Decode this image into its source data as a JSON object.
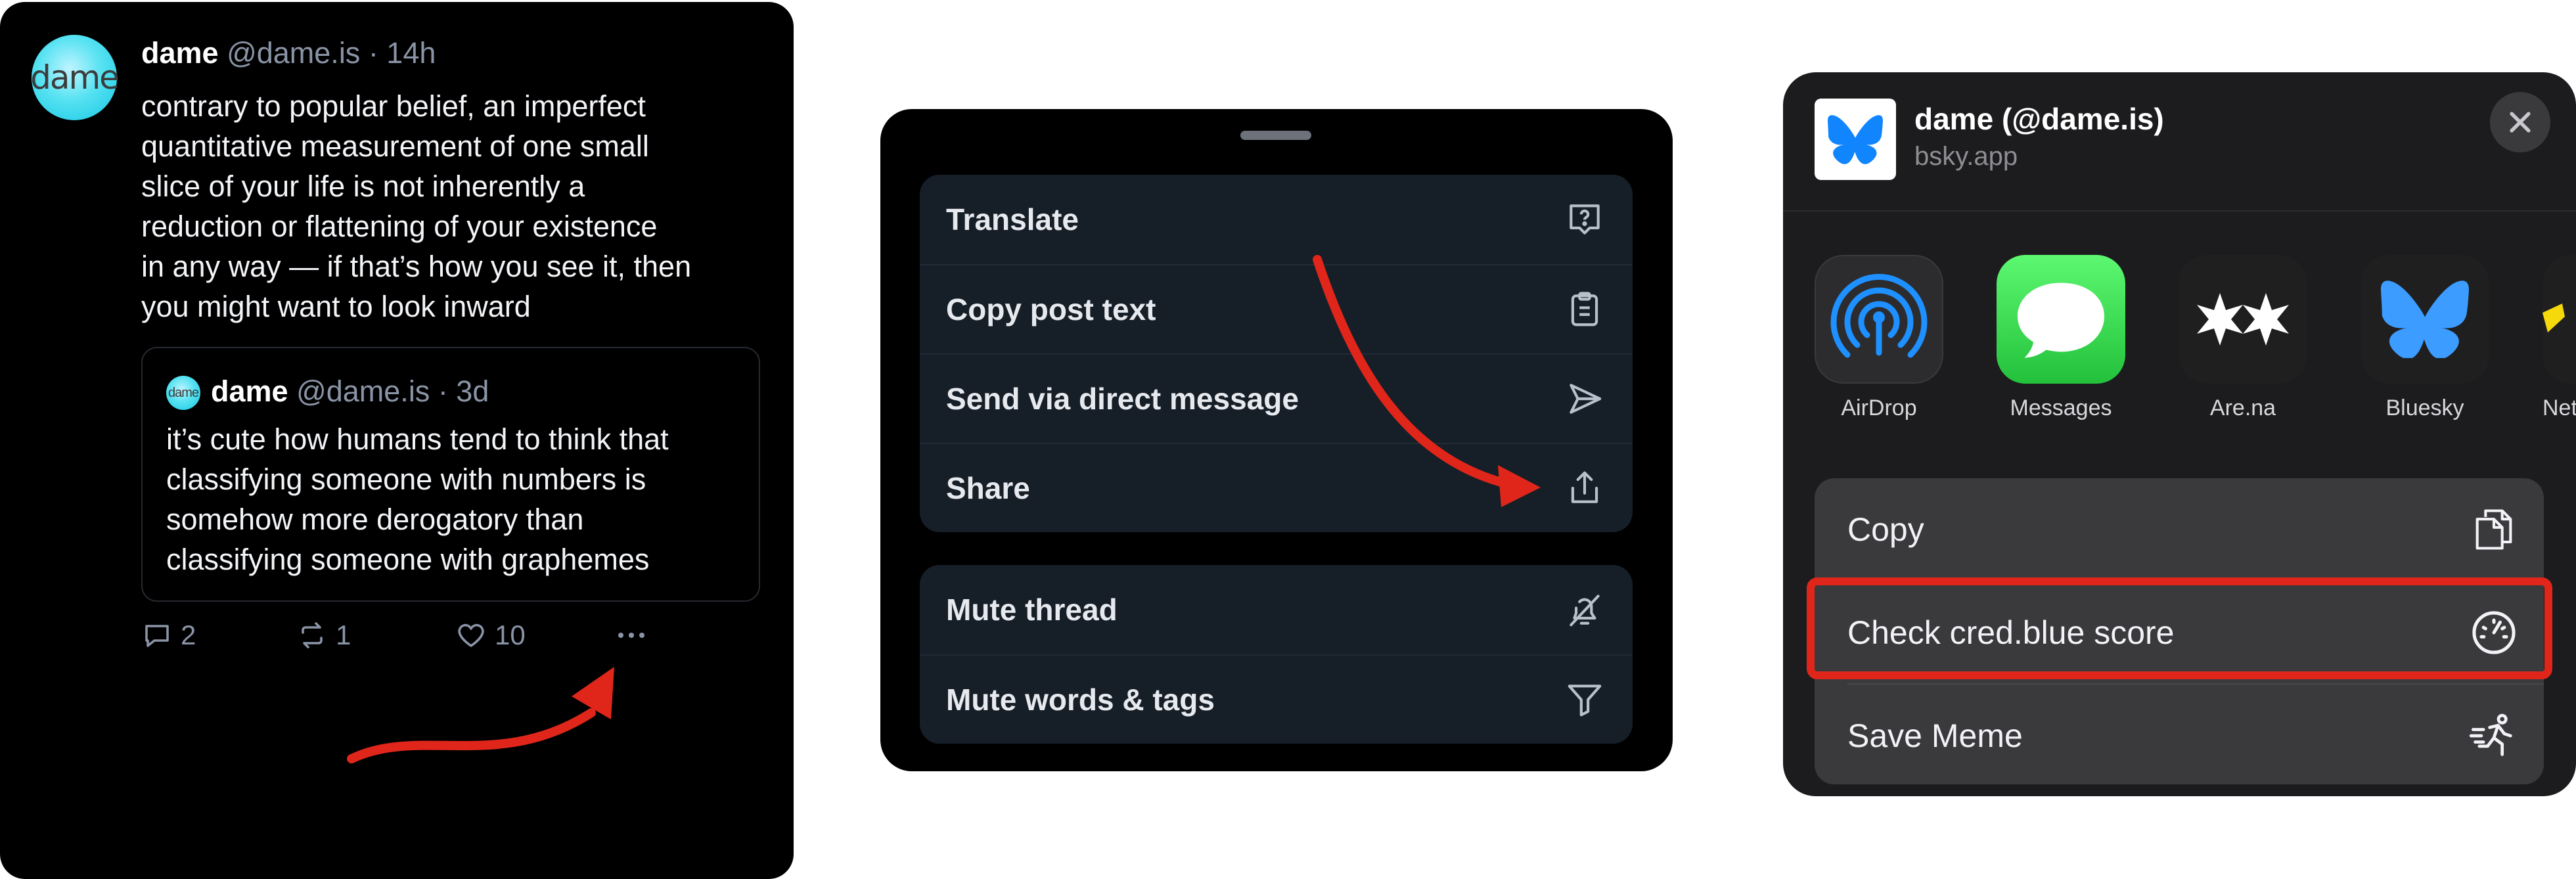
{
  "colors": {
    "accent_red": "#e0261a",
    "bluesky_blue": "#1185fe",
    "menu_bg": "#161e27"
  },
  "post": {
    "avatar_text": "dame",
    "author_name": "dame",
    "meta": " @dame.is · 14h",
    "text": "contrary to popular belief, an imperfect\nquantitative measurement of one small\nslice of your life is not inherently a\nreduction or flattening of your existence\nin any way — if that’s how you see it, then\nyou might want to look inward",
    "quote": {
      "avatar_text": "dame",
      "author_name": "dame",
      "meta": " @dame.is · 3d",
      "text": "it’s cute how humans tend to think that\nclassifying someone with numbers is\nsomehow more derogatory than\nclassifying someone with graphemes"
    },
    "actions": {
      "replies": "2",
      "reposts": "1",
      "likes": "10"
    }
  },
  "menu": {
    "group1": [
      "Translate",
      "Copy post text",
      "Send via direct message",
      "Share"
    ],
    "group2": [
      "Mute thread",
      "Mute words & tags"
    ]
  },
  "share_sheet": {
    "title": "dame (@dame.is)",
    "subtitle": "bsky.app",
    "apps": [
      "AirDrop",
      "Messages",
      "Are.na",
      "Bluesky",
      "Netl"
    ],
    "actions": [
      "Copy",
      "Check cred.blue score",
      "Save Meme"
    ]
  }
}
